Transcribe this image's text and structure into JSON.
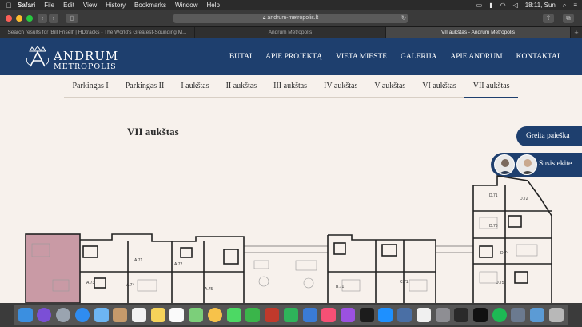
{
  "menubar": {
    "app": "Safari",
    "items": [
      "File",
      "Edit",
      "View",
      "History",
      "Bookmarks",
      "Window",
      "Help"
    ],
    "clock": "18:11, Sun"
  },
  "browser": {
    "url": "andrum-metropolis.lt",
    "tabs": [
      {
        "title": "Search results for 'Bill Frisell' | HDtracks - The World's Greatest-Sounding M..."
      },
      {
        "title": "Andrum Metropolis"
      },
      {
        "title": "VII aukštas - Andrum Metropolis"
      }
    ]
  },
  "site": {
    "logo_line1": "ANDRUM",
    "logo_line2": "METROPOLIS",
    "nav": [
      "BUTAI",
      "APIE PROJEKTĄ",
      "VIETA MIESTE",
      "GALERIJA",
      "APIE ANDRUM",
      "KONTAKTAI"
    ],
    "floors": [
      "Parkingas I",
      "Parkingas II",
      "I aukštas",
      "II aukštas",
      "III aukštas",
      "IV aukštas",
      "V aukštas",
      "VI aukštas",
      "VII aukštas"
    ],
    "active_floor": "VII aukštas",
    "page_title": "VII aukštas",
    "quick_search": "Greita paieška",
    "contact": "Susisiekite"
  },
  "plan_labels": [
    "A.71",
    "A.72",
    "A.73",
    "A.74",
    "A.75",
    "B.71",
    "C.71",
    "D.71",
    "D.72",
    "D.73",
    "D.74",
    "D.75"
  ],
  "colors": {
    "brand_navy": "#1e3f6e",
    "page_bg": "#f7f1ec",
    "highlight_unit": "#c99aa5"
  }
}
